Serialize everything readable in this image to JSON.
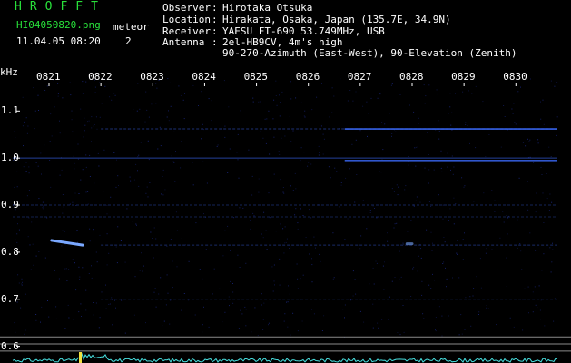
{
  "app": {
    "title": "HROFFT",
    "file_name": "HI04050820.png",
    "datetime": "11.04.05 08:20",
    "meteor_label": "meteor",
    "meteor_count": "2"
  },
  "station": {
    "observer_label": "Observer",
    "observer": "Hirotaka Otsuka",
    "location_label": "Location",
    "location": "Hirakata, Osaka, Japan (135.7E, 34.9N)",
    "receiver_label": "Receiver",
    "receiver": "YAESU FT-690 53.749MHz, USB",
    "antenna_label": "Antenna",
    "antenna_line1": "2el-HB9CV, 4m's high",
    "antenna_line2": "90-270-Azimuth (East-West), 90-Elevation (Zenith)"
  },
  "colors": {
    "title_green": "#28e03a",
    "background": "#000000",
    "signal_blue": "#3c6cff",
    "spectrum_cyan": "#48e0e0"
  },
  "chart_data": {
    "type": "heatmap",
    "y_unit_label": "kHz",
    "time_ticks": [
      "0821",
      "0822",
      "0823",
      "0824",
      "0825",
      "0826",
      "0827",
      "0828",
      "0829",
      "0830"
    ],
    "freq_ticks": [
      "1.1",
      "1.0",
      "0.9",
      "0.8",
      "0.7",
      "0.6"
    ],
    "freq_values": [
      1.1,
      1.0,
      0.9,
      0.8,
      0.7,
      0.6
    ],
    "ylim": [
      0.58,
      1.17
    ],
    "xlim": [
      8.2,
      830.8
    ],
    "carriers": [
      {
        "freq": 1.062,
        "t_start": 822.0,
        "t_end": 830.8,
        "strength": 0.45
      },
      {
        "freq": 1.062,
        "t_start": 826.7,
        "t_end": 830.8,
        "strength": 0.9
      },
      {
        "freq": 1.0,
        "t_start": 820.3,
        "t_end": 830.8,
        "strength": 0.6
      },
      {
        "freq": 0.995,
        "t_start": 826.7,
        "t_end": 830.8,
        "strength": 0.8
      },
      {
        "freq": 0.9,
        "t_start": 820.3,
        "t_end": 830.8,
        "strength": 0.35
      },
      {
        "freq": 0.875,
        "t_start": 820.3,
        "t_end": 830.8,
        "strength": 0.3
      },
      {
        "freq": 0.845,
        "t_start": 820.3,
        "t_end": 830.8,
        "strength": 0.3
      },
      {
        "freq": 0.815,
        "t_start": 822.0,
        "t_end": 830.8,
        "strength": 0.4
      },
      {
        "freq": 0.7,
        "t_start": 822.0,
        "t_end": 830.8,
        "strength": 0.3
      }
    ],
    "meteor_echoes": [
      {
        "t": 821.05,
        "freq_start": 0.825,
        "freq_end": 0.815,
        "duration": 0.6,
        "strength": 1.0
      },
      {
        "t": 827.9,
        "freq_start": 0.818,
        "freq_end": 0.818,
        "duration": 0.1,
        "strength": 0.6
      }
    ],
    "reference_lines": [
      0.62,
      0.605,
      0.59
    ]
  }
}
